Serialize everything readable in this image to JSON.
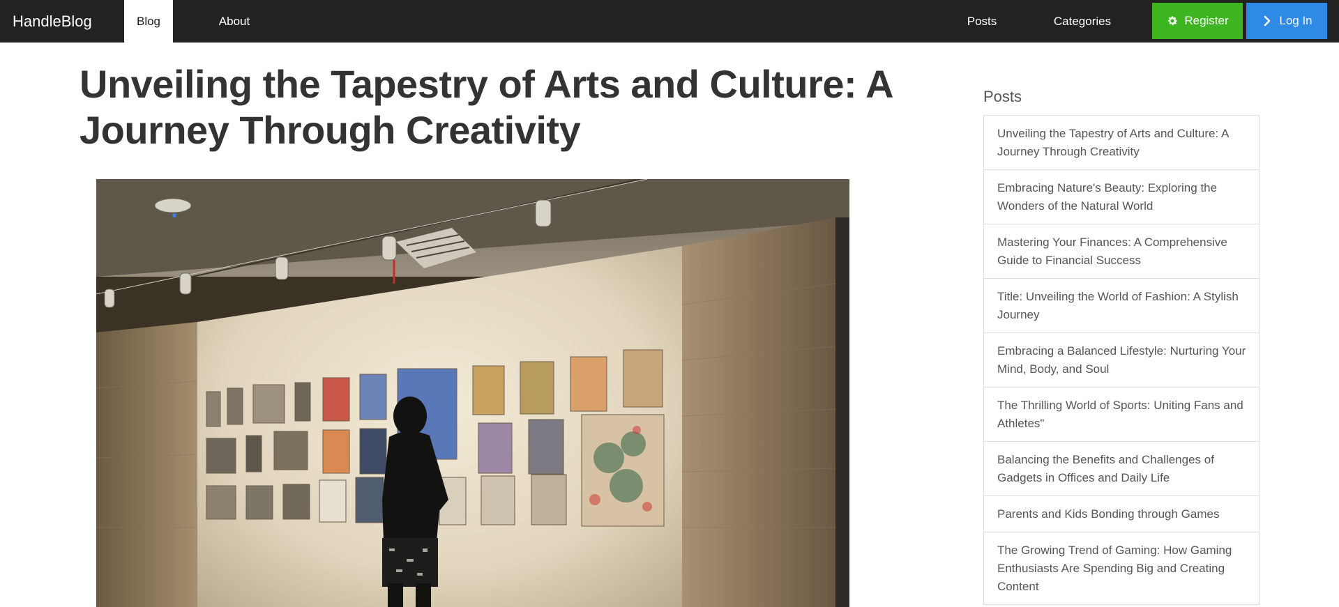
{
  "nav": {
    "brand": "HandleBlog",
    "left_links": [
      {
        "label": "Blog",
        "active": true
      },
      {
        "label": "About",
        "active": false
      }
    ],
    "right_links": [
      {
        "label": "Posts"
      },
      {
        "label": "Categories"
      }
    ],
    "register": {
      "label": "Register",
      "icon": "gear-icon",
      "color": "#3cb521"
    },
    "login": {
      "label": "Log In",
      "icon": "chevron-right-icon",
      "color": "#2f8ae6"
    }
  },
  "post": {
    "title": "Unveiling the Tapestry of Arts and Culture: A Journey Through Creativity",
    "image": {
      "subject": "gallery-photo"
    }
  },
  "sidebar": {
    "heading": "Posts",
    "items": [
      "Unveiling the Tapestry of Arts and Culture: A Journey Through Creativity",
      "Embracing Nature's Beauty: Exploring the Wonders of the Natural World",
      "Mastering Your Finances: A Comprehensive Guide to Financial Success",
      "Title: Unveiling the World of Fashion: A Stylish Journey",
      "Embracing a Balanced Lifestyle: Nurturing Your Mind, Body, and Soul",
      "The Thrilling World of Sports: Uniting Fans and Athletes\"",
      "Balancing the Benefits and Challenges of Gadgets in Offices and Daily Life",
      "Parents and Kids Bonding through Games",
      "The Growing Trend of Gaming: How Gaming Enthusiasts Are Spending Big and Creating Content"
    ]
  },
  "colors": {
    "navbar": "#222222",
    "text": "#333333",
    "register": "#3cb521",
    "login": "#2f8ae6"
  }
}
